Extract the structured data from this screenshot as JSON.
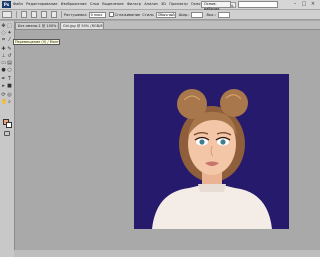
{
  "menubar": {
    "logo": "Ps",
    "items": [
      "Файл",
      "Редактирование",
      "Изображение",
      "Слои",
      "Выделение",
      "Фильтр",
      "Анализ",
      "3D",
      "Просмотр",
      "Окно",
      "Справка"
    ],
    "zoom": "50%",
    "workspace": "Основ. рабочая",
    "window_controls": [
      "–",
      "□",
      "×"
    ]
  },
  "options": {
    "feather_label": "Растушевка",
    "feather_value": "0 пикс",
    "antialias_label": "Сглаживание",
    "style_label": "Стиль",
    "style_value": "Обычный",
    "width_label": "Шир.:",
    "height_label": "Выс.:"
  },
  "tabs": [
    {
      "label": "Без имени-1 @ 100% (RGB/8)"
    },
    {
      "label": "Girl.jpg @ 50% (RGB/8)"
    }
  ],
  "tooltip": {
    "text": "Перемещение (V) / Монтаж"
  },
  "colors": {
    "canvas_bg": "#261a6c",
    "skin": "#f3c6a8",
    "hair": "#a9774c",
    "top": "#f4ece6",
    "foreground": "#f0a57a",
    "background": "#ffffff"
  }
}
